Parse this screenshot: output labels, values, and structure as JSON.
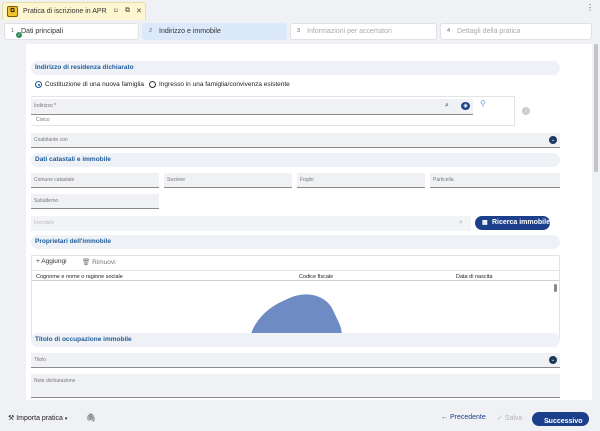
{
  "window": {
    "tab_title": "Pratica di iscrizione in APR",
    "tab_icon": "app-badge-icon",
    "menu": "⋮"
  },
  "stepper": [
    {
      "num": "1",
      "label": "Dati principali",
      "state": "done"
    },
    {
      "num": "2",
      "label": "Indirizzo e immobile",
      "state": "active"
    },
    {
      "num": "3",
      "label": "Informazioni per accertatori",
      "state": "disabled"
    },
    {
      "num": "4",
      "label": "Dettagli della pratica",
      "state": "disabled"
    }
  ],
  "sections": {
    "residenza": "Indirizzo di residenza dichiarato",
    "catastali": "Dati catastali e immobile",
    "proprietari": "Proprietari dell'immobile",
    "titolo": "Titolo di occupazione immobile"
  },
  "radio": {
    "opt1": "Costituzione di una nuova famiglia",
    "opt2": "Ingresso in una famiglia/convivenza esistente",
    "selected": "opt1"
  },
  "indirizzo": {
    "label": "Indirizzo",
    "required": "*",
    "sub": "Civico"
  },
  "coabitante": {
    "placeholder": "Coabitante con"
  },
  "catasto": {
    "comune": "Comune catastale",
    "sezione": "Sezione",
    "foglio": "Foglio",
    "particella": "Particella",
    "subalterno": "Subalterno",
    "immobile": "Immobile"
  },
  "buttons": {
    "ricerca": "Ricerca immobile",
    "aggiungi": "Aggiungi",
    "rimuovi": "Rimuovi"
  },
  "table": {
    "columns": [
      "Cognome e nome o ragione sociale",
      "Codice fiscale",
      "Data di nascita"
    ]
  },
  "titolo_fields": {
    "titolo": "Titolo",
    "note": "Note dichiarazione"
  },
  "footer": {
    "importa": "Importa pratica",
    "precedente": "Precedente",
    "salva": "Salva",
    "successivo": "Successivo"
  },
  "colors": {
    "accent": "#1c3f8c",
    "section_title": "#1f5c99",
    "tab_bg": "#fdf6d0"
  }
}
